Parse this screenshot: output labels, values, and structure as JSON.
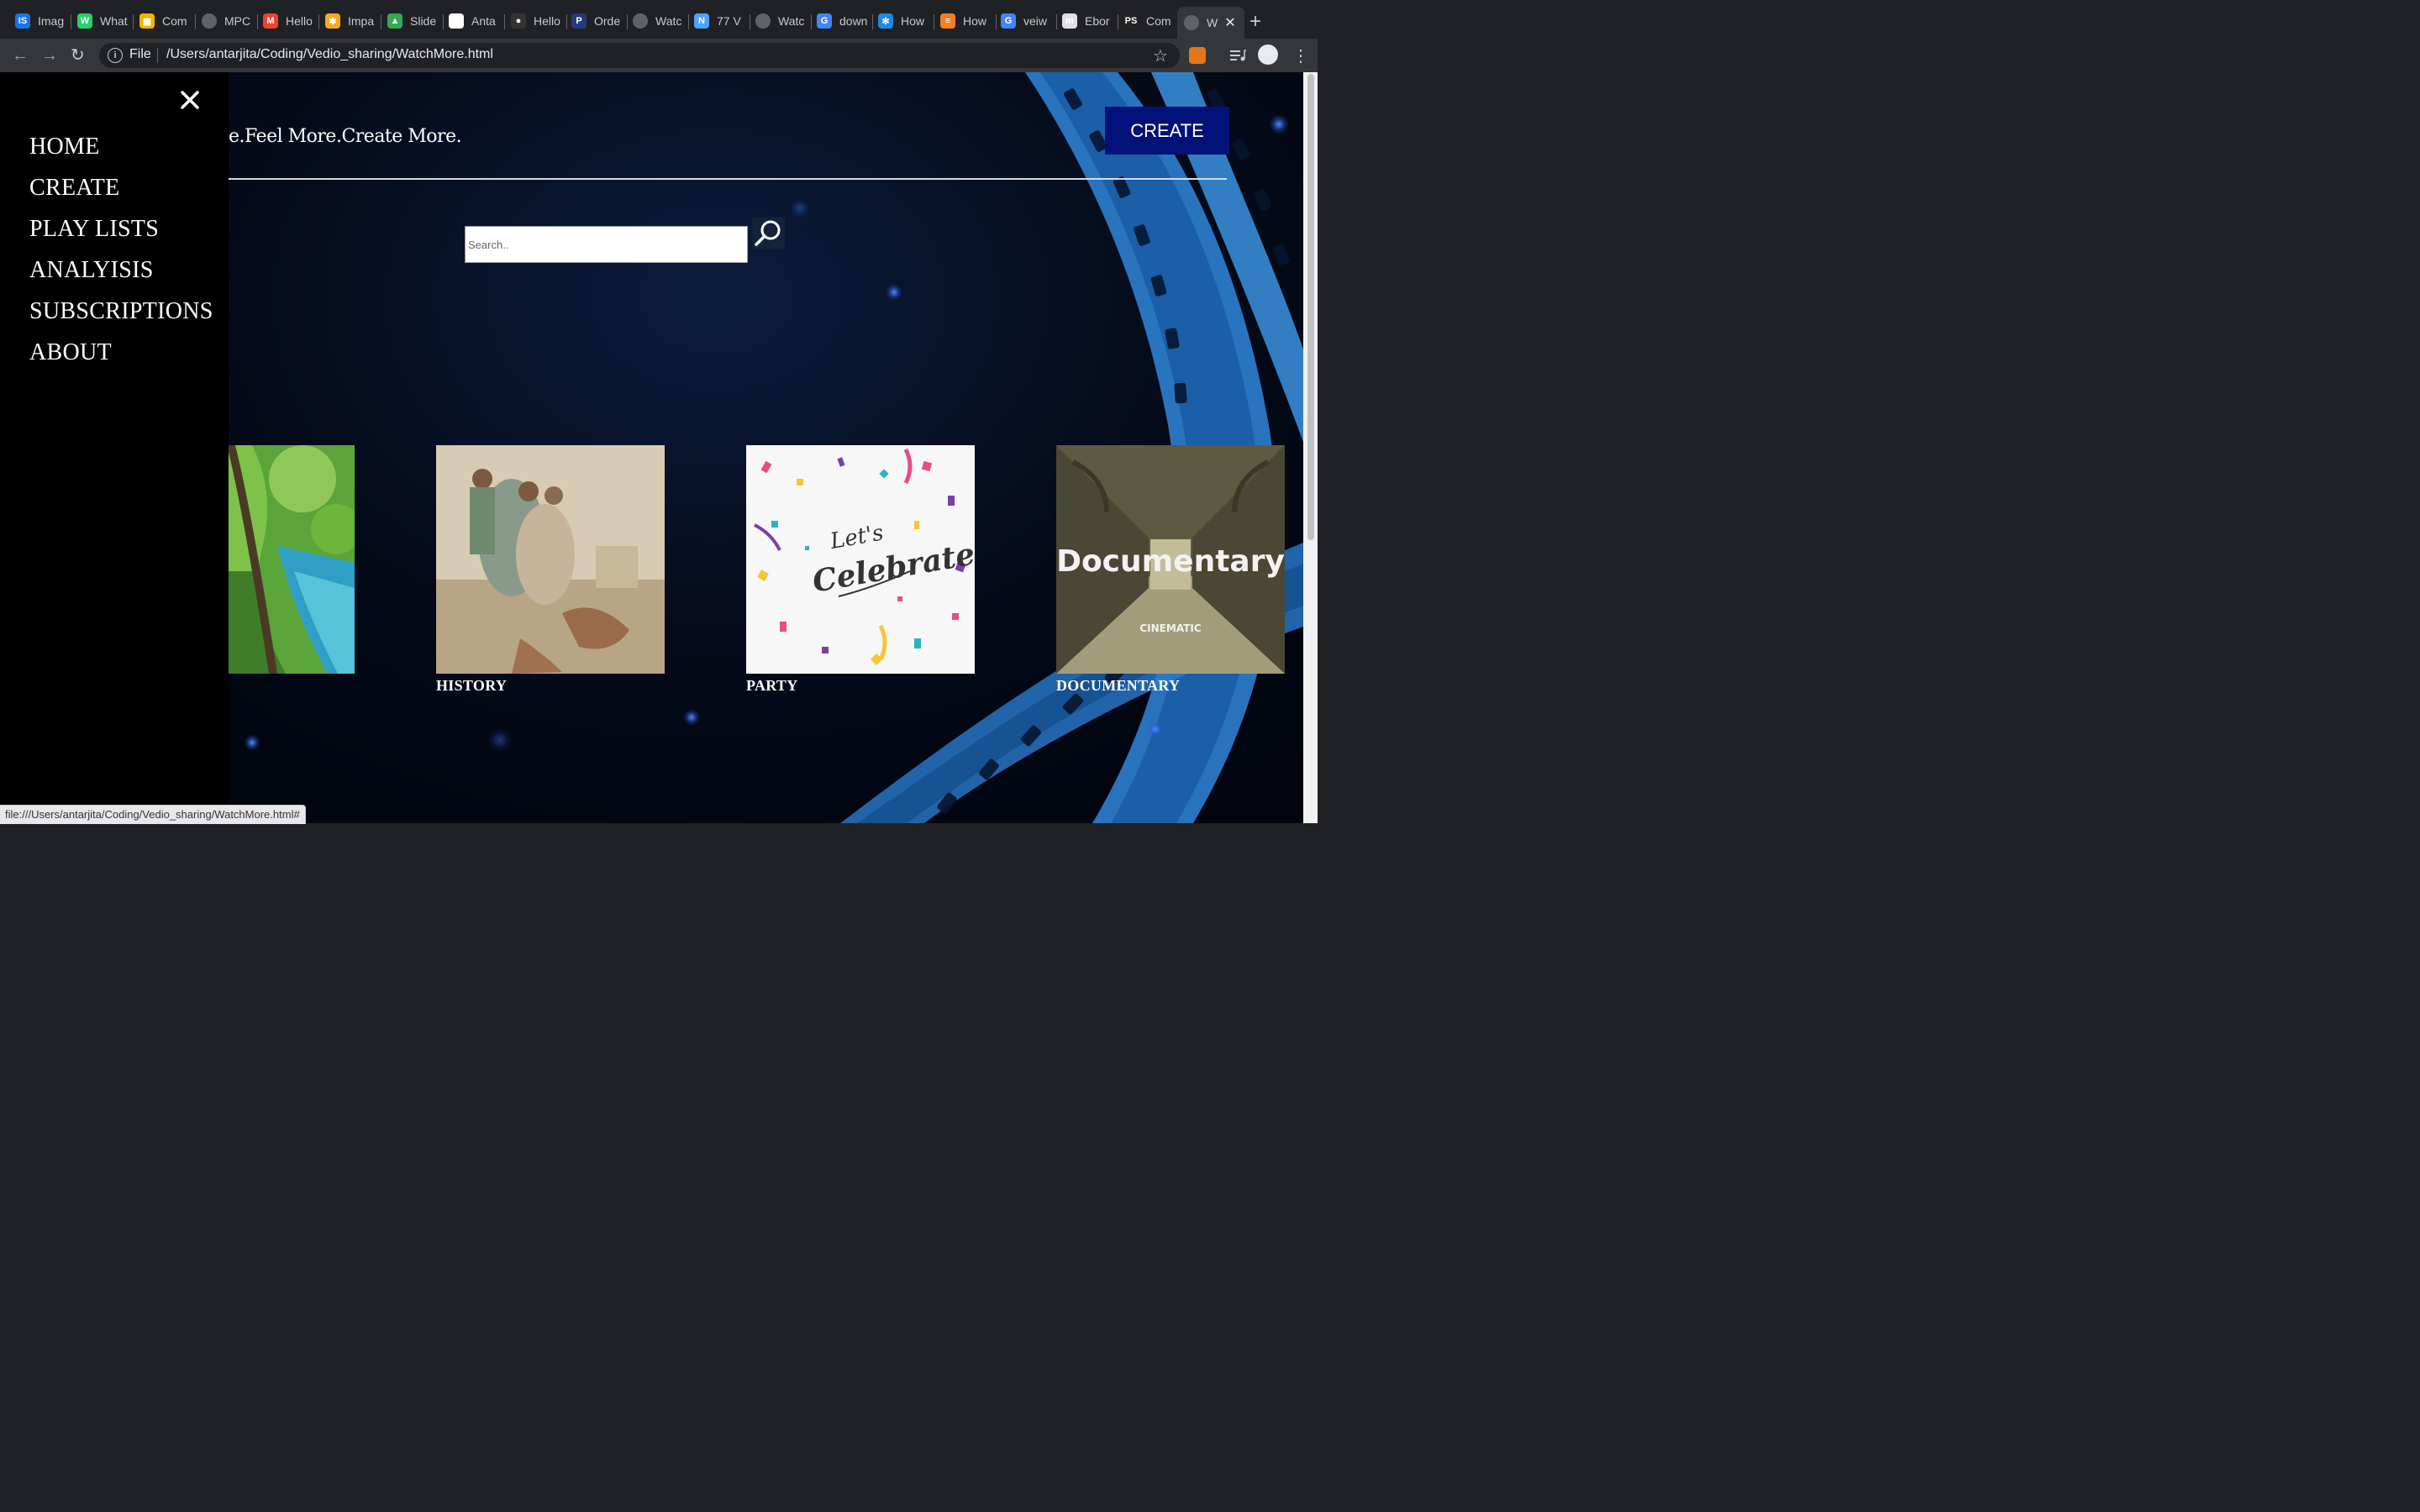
{
  "browser": {
    "tabs": [
      {
        "label": "Imag",
        "icon": "is-icon",
        "color": "#1a73e8"
      },
      {
        "label": "What",
        "icon": "whatsapp-icon",
        "color": "#25d366"
      },
      {
        "label": "Com",
        "icon": "grid-icon",
        "color": "#f4b400"
      },
      {
        "label": "MPC",
        "icon": "globe-icon",
        "color": "#5f6368"
      },
      {
        "label": "Hello",
        "icon": "gmail-icon",
        "color": "#ea4335"
      },
      {
        "label": "Impa",
        "icon": "asterisk-icon",
        "color": "#f9a825"
      },
      {
        "label": "Slide",
        "icon": "drive-icon",
        "color": "#34a853"
      },
      {
        "label": "Anta",
        "icon": "github-icon",
        "color": "#ffffff"
      },
      {
        "label": "Hello",
        "icon": "github-icon",
        "color": "#333333"
      },
      {
        "label": "Orde",
        "icon": "p-icon",
        "color": "#253b80"
      },
      {
        "label": "Watc",
        "icon": "globe-icon",
        "color": "#5f6368"
      },
      {
        "label": "77 V",
        "icon": "n-icon",
        "color": "#4da3ff"
      },
      {
        "label": "Watc",
        "icon": "globe-icon",
        "color": "#5f6368"
      },
      {
        "label": "down",
        "icon": "google-icon",
        "color": "#4285f4"
      },
      {
        "label": "How",
        "icon": "snowflake-icon",
        "color": "#1e88e5"
      },
      {
        "label": "How",
        "icon": "stack-icon",
        "color": "#f48024"
      },
      {
        "label": "veiw",
        "icon": "google-icon",
        "color": "#4285f4"
      },
      {
        "label": "Ebor",
        "icon": "m-icon",
        "color": "#e0e0e0"
      },
      {
        "label": "Com",
        "icon": "ps-icon",
        "color": "#222222"
      },
      {
        "label": "W",
        "icon": "globe-icon",
        "color": "#5f6368"
      }
    ],
    "omnibox": {
      "scheme_label": "File",
      "url": "/Users/antarjita/Coding/Vedio_sharing/WatchMore.html"
    },
    "status_url": "file:///Users/antarjita/Coding/Vedio_sharing/WatchMore.html#"
  },
  "page": {
    "tagline": "e.Feel More.Create More.",
    "create_button": "CREATE",
    "search": {
      "placeholder": "Search..",
      "value": ""
    },
    "sidenav": {
      "close_icon": "close-icon",
      "items": [
        "HOME",
        "CREATE",
        "PLAY LISTS",
        "ANALYISIS",
        "SUBSCRIPTIONS",
        "ABOUT"
      ]
    },
    "categories": [
      {
        "label": "",
        "image": "nature-river-image"
      },
      {
        "label": "HISTORY",
        "image": "fresco-painting-image"
      },
      {
        "label": "PARTY",
        "image": "confetti-celebrate-image",
        "image_text": [
          "Let's",
          "Celebrate"
        ]
      },
      {
        "label": "DOCUMENTARY",
        "image": "cloister-corridor-image",
        "image_text": [
          "Documentary",
          "CINEMATIC"
        ]
      }
    ]
  }
}
